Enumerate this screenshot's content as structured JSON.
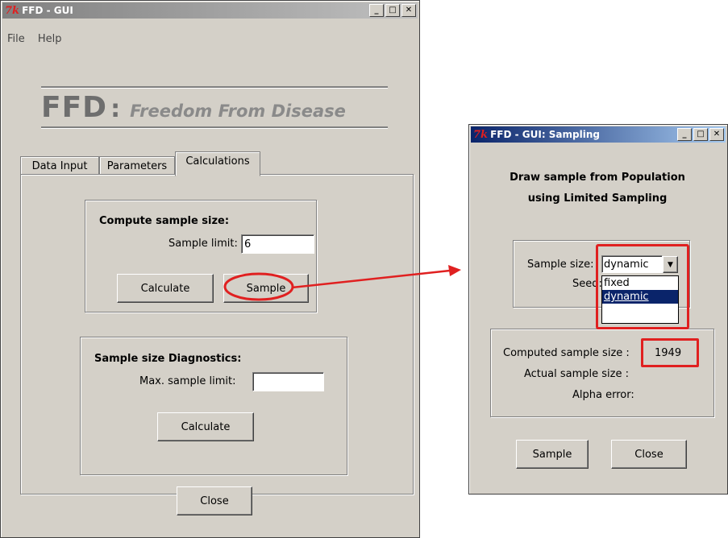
{
  "main_window": {
    "title": "FFD - GUI",
    "menu": [
      "File",
      "Help"
    ],
    "logo_short": "FFD",
    "logo_colon": ":",
    "logo_tagline": "Freedom From Disease",
    "tabs": [
      "Data Input",
      "Parameters",
      "Calculations"
    ],
    "active_tab": "Calculations",
    "compute_group": {
      "heading": "Compute sample size:",
      "sample_limit_label": "Sample limit:",
      "sample_limit_value": "6",
      "calculate_label": "Calculate",
      "sample_label": "Sample"
    },
    "diagnostics_group": {
      "heading": "Sample size Diagnostics:",
      "max_limit_label": "Max. sample limit:",
      "max_limit_value": "",
      "calculate_label": "Calculate"
    },
    "close_label": "Close"
  },
  "sampling_window": {
    "title": "FFD - GUI: Sampling",
    "heading_line1": "Draw sample from Population",
    "heading_line2": "using Limited Sampling",
    "sample_size_label": "Sample size:",
    "sample_size_value": "dynamic",
    "seed_label": "Seed:",
    "dropdown_options": [
      "fixed",
      "dynamic"
    ],
    "dropdown_selected": "dynamic",
    "computed_label": "Computed sample size :",
    "computed_value": "1949",
    "actual_label": "Actual sample size :",
    "alpha_label": "Alpha error:",
    "sample_label": "Sample",
    "close_label": "Close"
  },
  "window_controls": {
    "minimize": "_",
    "maximize": "□",
    "close": "✕"
  },
  "annotation_color": "#e02020"
}
